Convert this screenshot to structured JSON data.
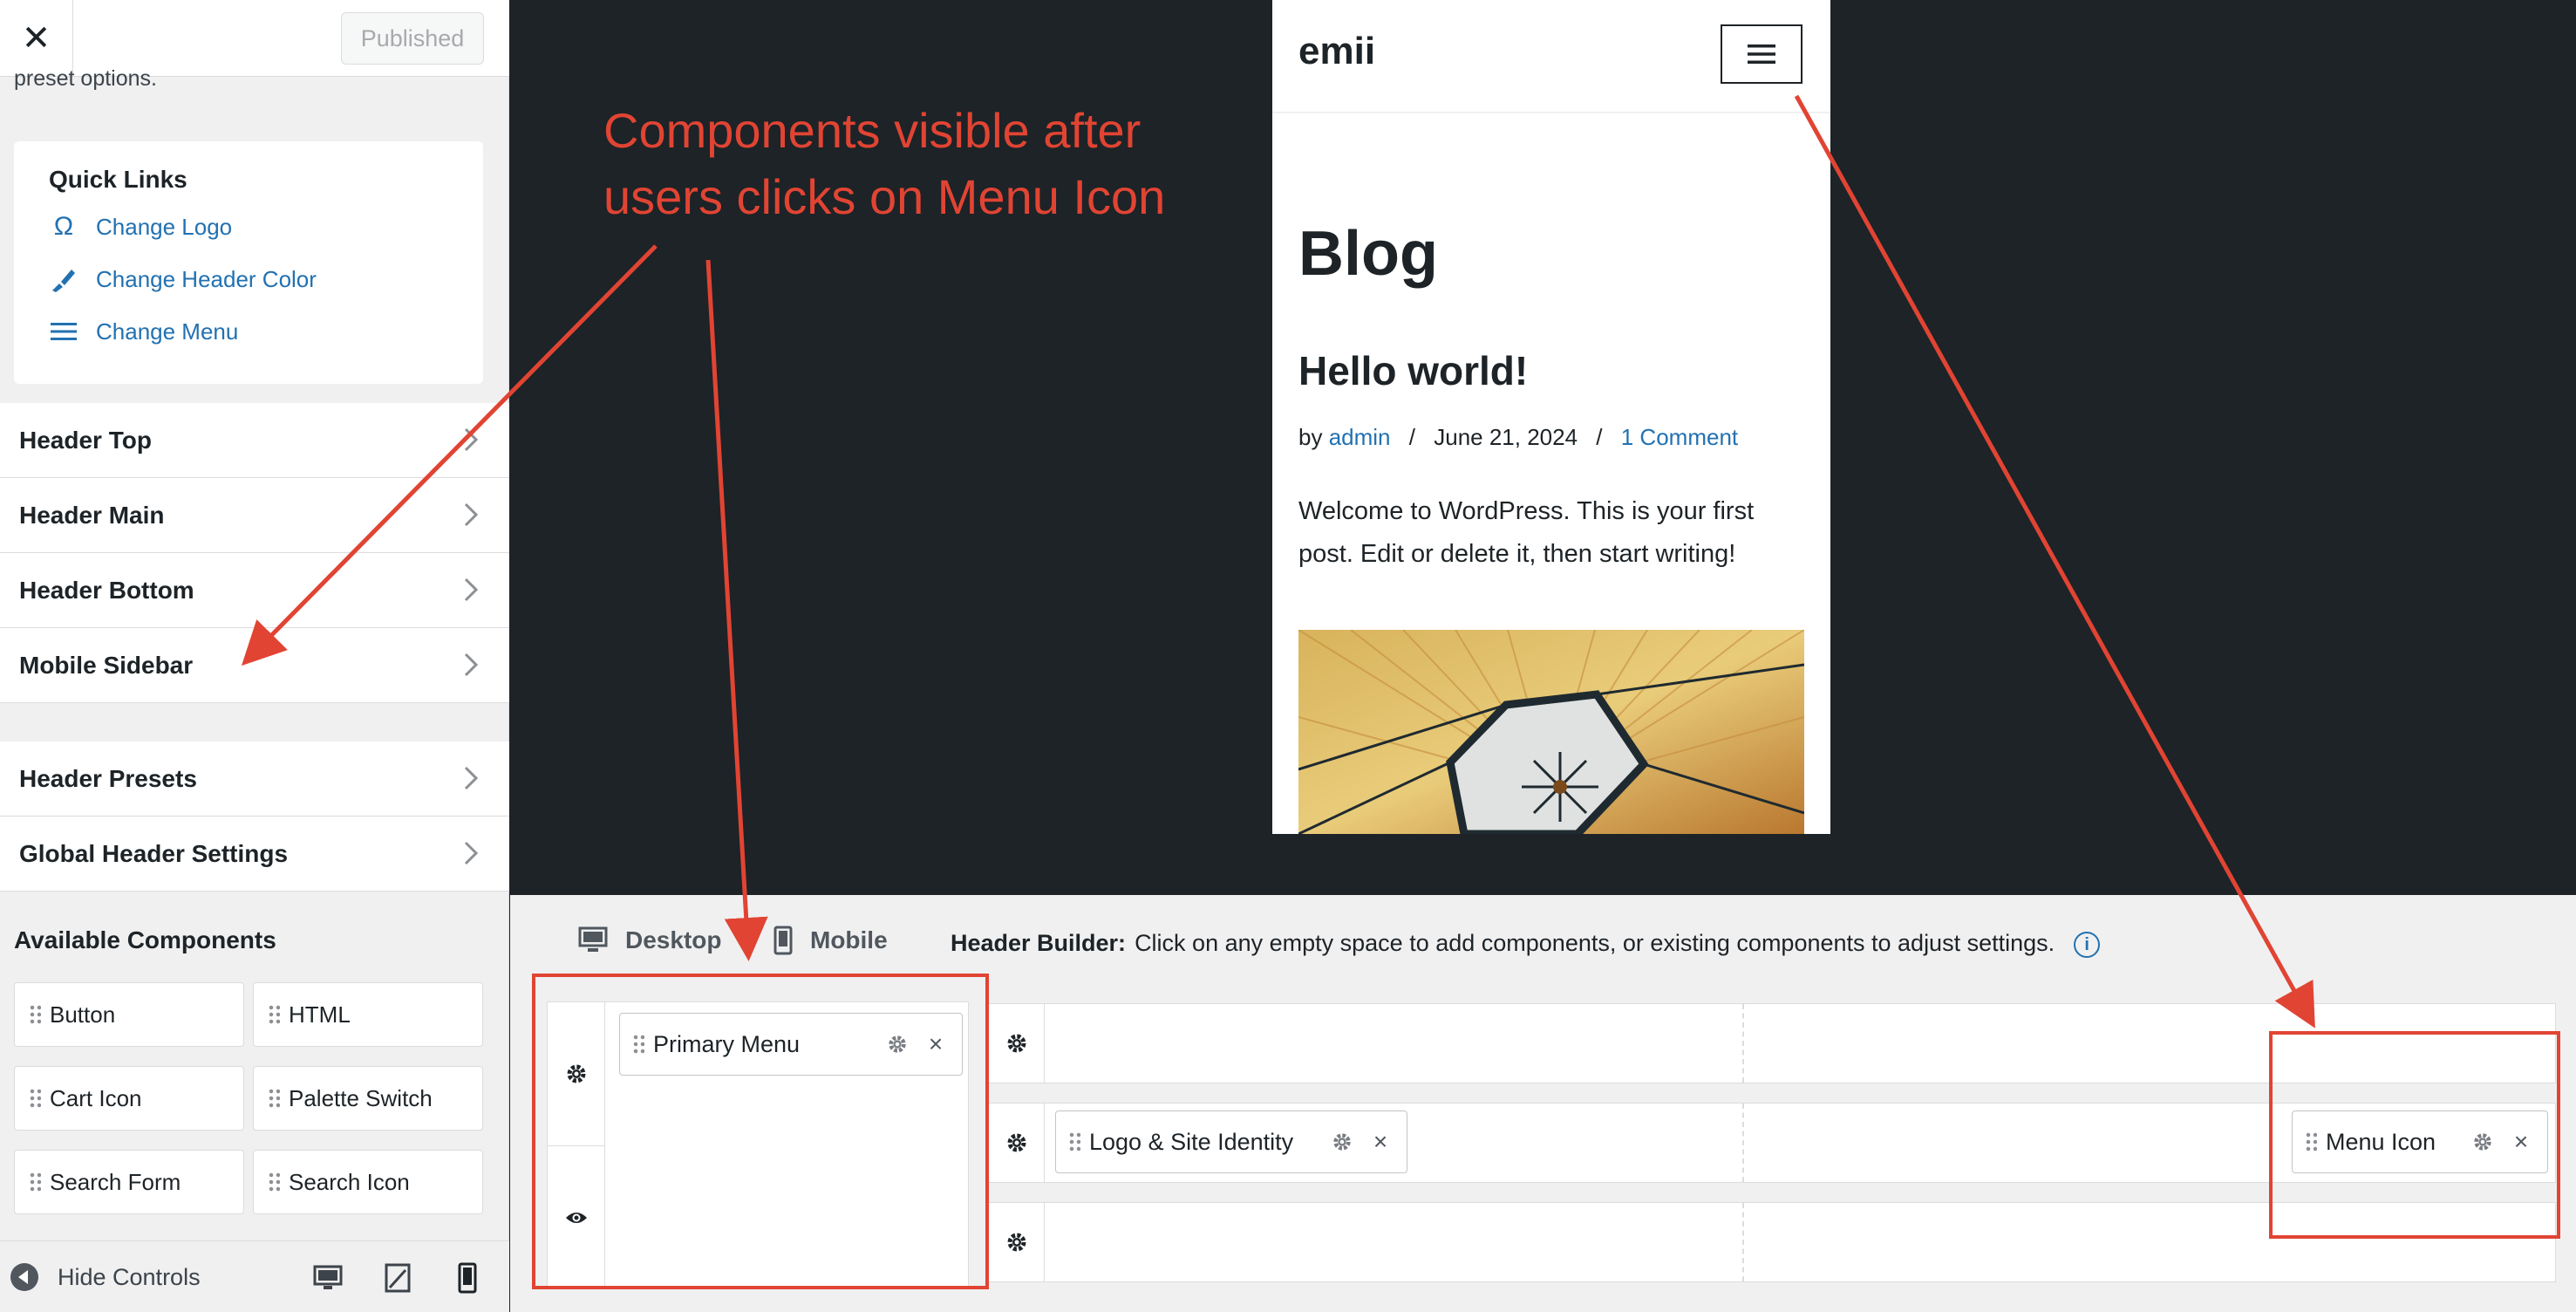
{
  "sidebar": {
    "close_label": "✕",
    "published_label": "Published",
    "preset_text": "preset options.",
    "quick_links": {
      "title": "Quick Links",
      "items": [
        {
          "label": "Change Logo",
          "icon": "omega-icon"
        },
        {
          "label": "Change Header Color",
          "icon": "paintbrush-icon"
        },
        {
          "label": "Change Menu",
          "icon": "menu-lines-icon"
        }
      ]
    },
    "sections": [
      "Header Top",
      "Header Main",
      "Header Bottom",
      "Mobile Sidebar",
      "Header Presets",
      "Global Header Settings"
    ],
    "available_components": {
      "title": "Available Components",
      "items": [
        "Button",
        "HTML",
        "Cart Icon",
        "Palette Switch",
        "Search Form",
        "Search Icon"
      ]
    },
    "footer": {
      "hide_controls_label": "Hide Controls",
      "device_icons": [
        "desktop-icon",
        "tablet-icon",
        "mobile-icon"
      ]
    }
  },
  "preview": {
    "site_title": "emii",
    "page_title": "Blog",
    "post": {
      "title": "Hello world!",
      "meta_by": "by",
      "author": "admin",
      "separator": "/",
      "date": "June 21, 2024",
      "comments": "1 Comment",
      "excerpt": "Welcome to WordPress. This is your first post. Edit or delete it, then start writing!"
    }
  },
  "builder": {
    "tabs": {
      "desktop": "Desktop",
      "mobile": "Mobile"
    },
    "help_label": "Header Builder:",
    "help_text": "Click on any empty space to add components, or existing components to adjust settings.",
    "info_icon": "i",
    "sidebar_components": [
      "Primary Menu"
    ],
    "rows": {
      "top": [],
      "main": {
        "left": [
          "Logo & Site Identity"
        ],
        "right": [
          "Menu Icon"
        ]
      },
      "bottom": []
    },
    "chip_close": "×"
  },
  "annotation": {
    "line1": "Components visible after",
    "line2": "users clicks on Menu Icon",
    "color": "#e14433"
  },
  "colors": {
    "accent": "#2271b1",
    "preview_bg": "#1d2327",
    "panel_bg": "#f0f0f1"
  }
}
